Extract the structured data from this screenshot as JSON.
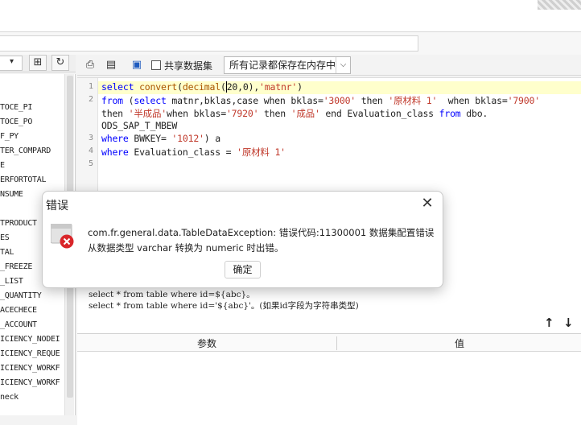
{
  "toolbar": {
    "share_label": "共享数据集",
    "save_mode": "所有记录都保存在内存中"
  },
  "tree": {
    "items": [
      "TOCE_PI",
      "TOCE_PO",
      "F_PY",
      "TER_COMPARD",
      "E",
      "ERFORTOTAL",
      "NSUME",
      "",
      "TPRODUCT",
      "ES",
      "TAL",
      "_FREEZE",
      "_LIST",
      "_QUANTITY",
      "ACECHECE",
      "_ACCOUNT",
      "ICIENCY_NODEI",
      "ICIENCY_REQUE",
      "ICIENCY_WORKF",
      "ICIENCY_WORKF",
      "neck"
    ]
  },
  "editor": {
    "line_numbers": [
      "1",
      "2",
      "",
      "",
      "3",
      "4",
      "5"
    ]
  },
  "hint": {
    "line1": "select * from table where id=${abc}。",
    "line2": "select * from table where id='${abc}'。(如果id字段为字符串类型)"
  },
  "params": {
    "col_param": "参数",
    "col_value": "值"
  },
  "dialog": {
    "title": "错误",
    "message_line1": "com.fr.general.data.TableDataException: 错误代码:11300001 数据集配置错误",
    "message_line2": "从数据类型 varchar 转换为 numeric 时出错。",
    "ok_label": "确定"
  }
}
